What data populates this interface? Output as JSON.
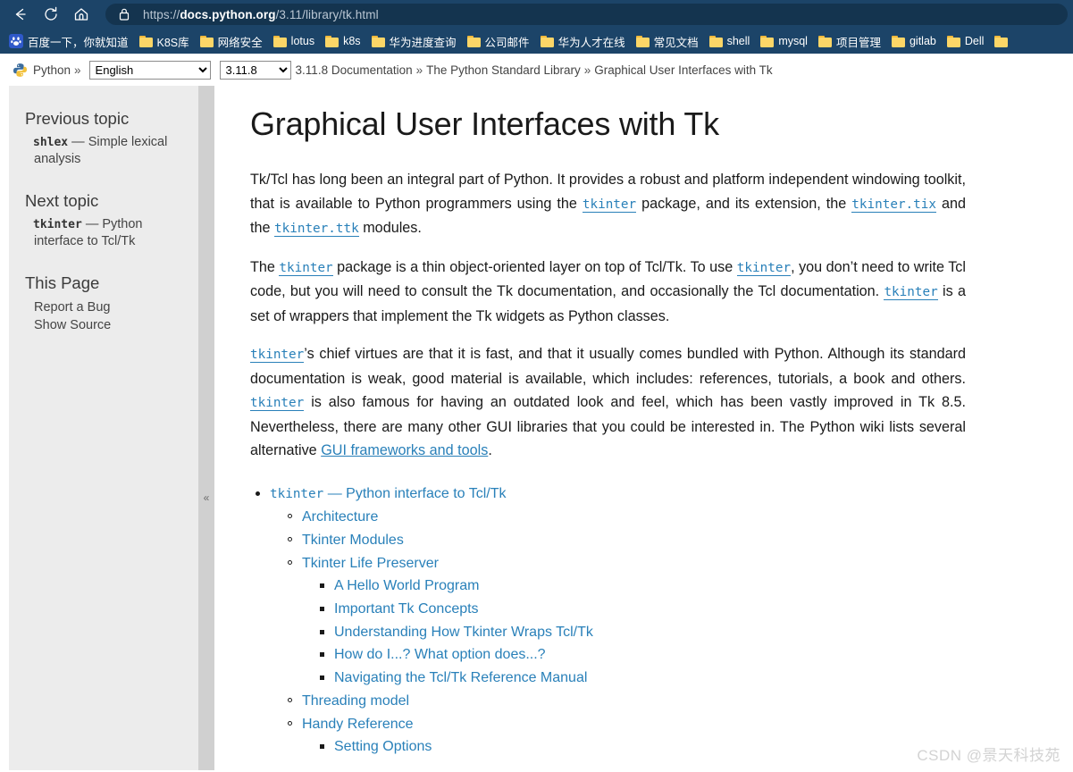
{
  "browser": {
    "back_label": "Back",
    "reload_label": "Reload",
    "home_label": "Home",
    "url_prefix": "https://",
    "url_host": "docs.python.org",
    "url_path": "/3.11/library/tk.html",
    "lock_icon": "lock-icon"
  },
  "bookmarks": [
    {
      "label": "百度一下，你就知道",
      "icon": "baidu-favicon"
    },
    {
      "label": "K8S库",
      "icon": "folder-icon"
    },
    {
      "label": "网络安全",
      "icon": "folder-icon"
    },
    {
      "label": "lotus",
      "icon": "folder-icon"
    },
    {
      "label": "k8s",
      "icon": "folder-icon"
    },
    {
      "label": "华为进度查询",
      "icon": "folder-icon"
    },
    {
      "label": "公司邮件",
      "icon": "folder-icon"
    },
    {
      "label": "华为人才在线",
      "icon": "folder-icon"
    },
    {
      "label": "常见文档",
      "icon": "folder-icon"
    },
    {
      "label": "shell",
      "icon": "folder-icon"
    },
    {
      "label": "mysql",
      "icon": "folder-icon"
    },
    {
      "label": "项目管理",
      "icon": "folder-icon"
    },
    {
      "label": "gitlab",
      "icon": "folder-icon"
    },
    {
      "label": "Dell",
      "icon": "folder-icon"
    }
  ],
  "related": {
    "brand": "Python",
    "sep1": "»",
    "language": {
      "selected": "English",
      "options": [
        "English"
      ]
    },
    "version": {
      "selected": "3.11.8",
      "options": [
        "3.11.8"
      ]
    },
    "crumb1": "3.11.8 Documentation",
    "sep2": "»",
    "crumb2": "The Python Standard Library",
    "sep3": "»",
    "crumb3": "Graphical User Interfaces with Tk"
  },
  "sidebar": {
    "previous_title": "Previous topic",
    "previous_code": "shlex",
    "previous_text": " — Simple lexical analysis",
    "next_title": "Next topic",
    "next_code": "tkinter",
    "next_text": " — Python interface to Tcl/Tk",
    "this_page_title": "This Page",
    "this_page_links": [
      "Report a Bug",
      "Show Source"
    ],
    "collapse_glyph": "«"
  },
  "content": {
    "title": "Graphical User Interfaces with Tk",
    "p1": {
      "t1": "Tk/Tcl has long been an integral part of Python. It provides a robust and platform independent windowing toolkit, that is available to Python programmers using the ",
      "c1": "tkinter",
      "t2": " package, and its extension, the ",
      "c2": "tkinter.tix",
      "t3": " and the ",
      "c3": "tkinter.ttk",
      "t4": " modules."
    },
    "p2": {
      "t1": "The ",
      "c1": "tkinter",
      "t2": " package is a thin object-oriented layer on top of Tcl/Tk. To use ",
      "c2": "tkinter",
      "t3": ", you don’t need to write Tcl code, but you will need to consult the Tk documentation, and occasionally the Tcl documentation. ",
      "c3": "tkinter",
      "t4": " is a set of wrappers that implement the Tk widgets as Python classes."
    },
    "p3": {
      "c1": "tkinter",
      "t1": "’s chief virtues are that it is fast, and that it usually comes bundled with Python. Although its standard documentation is weak, good material is available, which includes: references, tutorials, a book and others. ",
      "c2": "tkinter",
      "t2": " is also famous for having an outdated look and feel, which has been vastly improved in Tk 8.5. Nevertheless, there are many other GUI libraries that you could be interested in. The Python wiki lists several alternative ",
      "link": "GUI frameworks and tools",
      "t3": "."
    }
  },
  "toc": {
    "root_code": "tkinter",
    "root_text": " — Python interface to Tcl/Tk",
    "items": [
      {
        "label": "Architecture",
        "children": []
      },
      {
        "label": "Tkinter Modules",
        "children": []
      },
      {
        "label": "Tkinter Life Preserver",
        "children": [
          "A Hello World Program",
          "Important Tk Concepts",
          "Understanding How Tkinter Wraps Tcl/Tk",
          "How do I...? What option does...?",
          "Navigating the Tcl/Tk Reference Manual"
        ]
      },
      {
        "label": "Threading model",
        "children": []
      },
      {
        "label": "Handy Reference",
        "children": [
          "Setting Options"
        ]
      }
    ]
  },
  "watermark": "CSDN @景天科技苑",
  "colors": {
    "chrome": "#1c4468",
    "url_bar": "#14344f",
    "link": "#2980b9",
    "sidebar_bg": "#ececec",
    "sidebar_edge": "#d0d0d0",
    "folder": "#fcd667"
  }
}
